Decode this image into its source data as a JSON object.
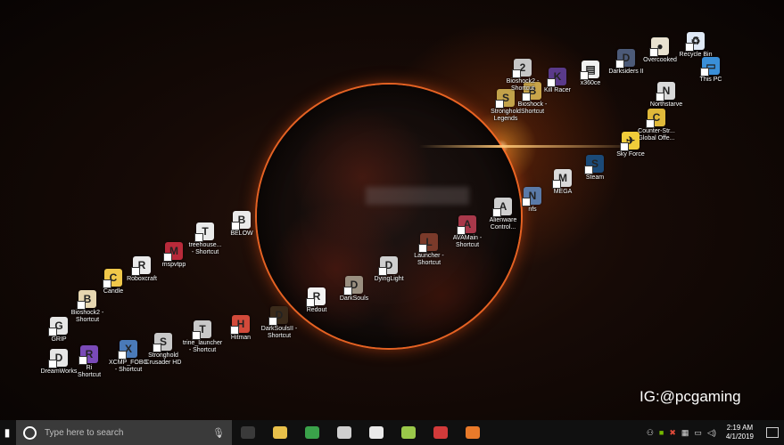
{
  "desktop": {
    "icons": [
      {
        "label": "Recycle Bin",
        "icon": "recycle-bin-icon",
        "color": "#dfe8f5",
        "glyph": "♻"
      },
      {
        "label": "This PC",
        "icon": "computer-icon",
        "color": "#3a8fd8",
        "glyph": "▭"
      },
      {
        "label": "Overcooked",
        "icon": "overcooked-icon",
        "color": "#e9e2d0",
        "glyph": "●"
      },
      {
        "label": "Darksiders II",
        "icon": "darksiders-icon",
        "color": "#4c5a78",
        "glyph": "D"
      },
      {
        "label": "x360ce",
        "icon": "file-icon",
        "color": "#f0f0f0",
        "glyph": "▤"
      },
      {
        "label": "Kill Racer",
        "icon": "kill-racer-icon",
        "color": "#5a3a8a",
        "glyph": "K"
      },
      {
        "label": "Bioshock -\nShortcut",
        "icon": "bioshock-icon",
        "color": "#c9a54a",
        "glyph": "B"
      },
      {
        "label": "Stronghold\nLegends",
        "icon": "stronghold-legends-icon",
        "color": "#c2a24a",
        "glyph": "S"
      },
      {
        "label": "Bioshock2 -\nShortcut",
        "icon": "bioshock2-icon",
        "color": "#c6c6c6",
        "glyph": "2"
      },
      {
        "label": "Counter-Str...\nGlobal Offe...",
        "icon": "csgo-icon",
        "color": "#e0b93a",
        "glyph": "C"
      },
      {
        "label": "Northstarve",
        "icon": "northstarve-icon",
        "color": "#d9d9d9",
        "glyph": "N"
      },
      {
        "label": "Sky Force",
        "icon": "sky-force-icon",
        "color": "#f0cc3a",
        "glyph": "✈"
      },
      {
        "label": "Steam",
        "icon": "steam-icon",
        "color": "#1b4a78",
        "glyph": "S"
      },
      {
        "label": "MEGA",
        "icon": "mega-icon",
        "color": "#dadada",
        "glyph": "M"
      },
      {
        "label": "nfs",
        "icon": "nfs-icon",
        "color": "#5a7aa8",
        "glyph": "N"
      },
      {
        "label": "Alienware\nControl...",
        "icon": "alienware-icon",
        "color": "#cfcfcf",
        "glyph": "A"
      },
      {
        "label": "AVAMain -\nShortcut",
        "icon": "avamain-icon",
        "color": "#a8384a",
        "glyph": "A"
      },
      {
        "label": "Launcher -\nShortcut",
        "icon": "launcher-icon",
        "color": "#7a3a2a",
        "glyph": "L"
      },
      {
        "label": "DyingLight",
        "icon": "dying-light-icon",
        "color": "#cfcfcf",
        "glyph": "D"
      },
      {
        "label": "DarkSouls",
        "icon": "dark-souls-icon",
        "color": "#9a8f80",
        "glyph": "D"
      },
      {
        "label": "Redout",
        "icon": "redout-icon",
        "color": "#f2f2f2",
        "glyph": "R"
      },
      {
        "label": "DarkSoulsII -\nShortcut",
        "icon": "dark-souls-2-icon",
        "color": "#3a2a1a",
        "glyph": "D"
      },
      {
        "label": "Hitman",
        "icon": "hitman-icon",
        "color": "#d24a3a",
        "glyph": "H"
      },
      {
        "label": "trine_launcher\n- Shortcut",
        "icon": "trine-icon",
        "color": "#c8c8c8",
        "glyph": "T"
      },
      {
        "label": "Stronghold\nCrusader HD",
        "icon": "stronghold-crusader-icon",
        "color": "#c8c8c8",
        "glyph": "S"
      },
      {
        "label": "XCMP_FOBG\n- Shortcut",
        "icon": "xcmp-icon",
        "color": "#4a7ab8",
        "glyph": "X"
      },
      {
        "label": "Ri\nShortcut",
        "icon": "ri-icon",
        "color": "#7a4ab8",
        "glyph": "R"
      },
      {
        "label": "DreamWorks",
        "icon": "dreamworks-icon",
        "color": "#e6e6e6",
        "glyph": "D"
      },
      {
        "label": "GRIP",
        "icon": "grip-icon",
        "color": "#e6e6e6",
        "glyph": "G"
      },
      {
        "label": "Bioshock2 -\nShortcut",
        "icon": "bioshock2-shortcut-icon",
        "color": "#e6d6b0",
        "glyph": "B"
      },
      {
        "label": "Candle",
        "icon": "candle-icon",
        "color": "#f0c84a",
        "glyph": "C"
      },
      {
        "label": "Roboxcraft",
        "icon": "roboxcraft-icon",
        "color": "#eaeaea",
        "glyph": "R"
      },
      {
        "label": "mspvtpp",
        "icon": "mspvtpp-icon",
        "color": "#b82a3a",
        "glyph": "M"
      },
      {
        "label": "treehouse...\n- Shortcut",
        "icon": "treehouse-icon",
        "color": "#eaeaea",
        "glyph": "T"
      },
      {
        "label": "BELOW",
        "icon": "below-icon",
        "color": "#eaeaea",
        "glyph": "B"
      }
    ]
  },
  "watermark": "IG:@pcgaming",
  "taskbar": {
    "start_icon": "windows-start-icon",
    "search_placeholder": "Type here to search",
    "pinned": [
      {
        "icon": "task-view-icon",
        "color": "#3a3a3a"
      },
      {
        "icon": "file-explorer-icon",
        "color": "#e8c04a"
      },
      {
        "icon": "chrome-icon",
        "color": "#3aa24a"
      },
      {
        "icon": "video-editor-icon",
        "color": "#cfcfcf"
      },
      {
        "icon": "obs-icon",
        "color": "#eaeaea"
      },
      {
        "icon": "game-launcher-icon",
        "color": "#9ac84a"
      },
      {
        "icon": "media-player-icon",
        "color": "#d23a3a"
      },
      {
        "icon": "app-icon",
        "color": "#e87a2a"
      }
    ],
    "clock_time": "2:19 AM",
    "clock_date": "4/1/2019"
  }
}
